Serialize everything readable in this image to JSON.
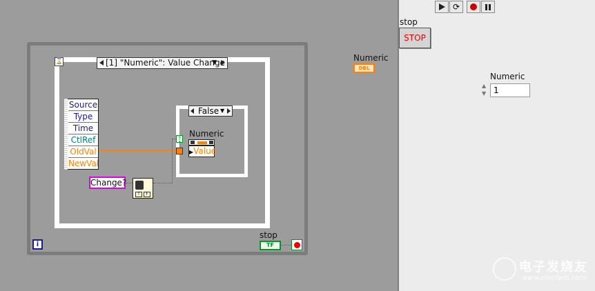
{
  "block_diagram": {
    "event_selector_label": "[1] \"Numeric\": Value Change",
    "event_data_items": [
      "Source",
      "Type",
      "Time",
      "CtlRef",
      "OldVal",
      "NewVal"
    ],
    "case_selector_label": "False",
    "case_indicator_label": "Numeric",
    "property_node_label": "Value",
    "change_label": "Change?",
    "control_terminal_label": "Numeric",
    "control_terminal_type": "DBL",
    "stop_terminal_label": "stop",
    "stop_terminal_type": "TF",
    "iteration_label": "i",
    "colors": {
      "background": "#9c9c9c",
      "orange": "#ff7f00",
      "blue": "#1a1aa0",
      "teal": "#0a7c7c",
      "green": "#0c8f2c",
      "magenta": "#e000e0"
    }
  },
  "front_panel": {
    "stop_label": "stop",
    "stop_button_text": "STOP",
    "numeric_label": "Numeric",
    "numeric_value": "1"
  },
  "toolbar": {
    "icons": [
      "run-arrow-icon",
      "run-continuously-icon",
      "abort-icon",
      "pause-icon"
    ]
  },
  "watermark": {
    "brand": "电子发烧友",
    "url": "www.elecfans.com"
  }
}
